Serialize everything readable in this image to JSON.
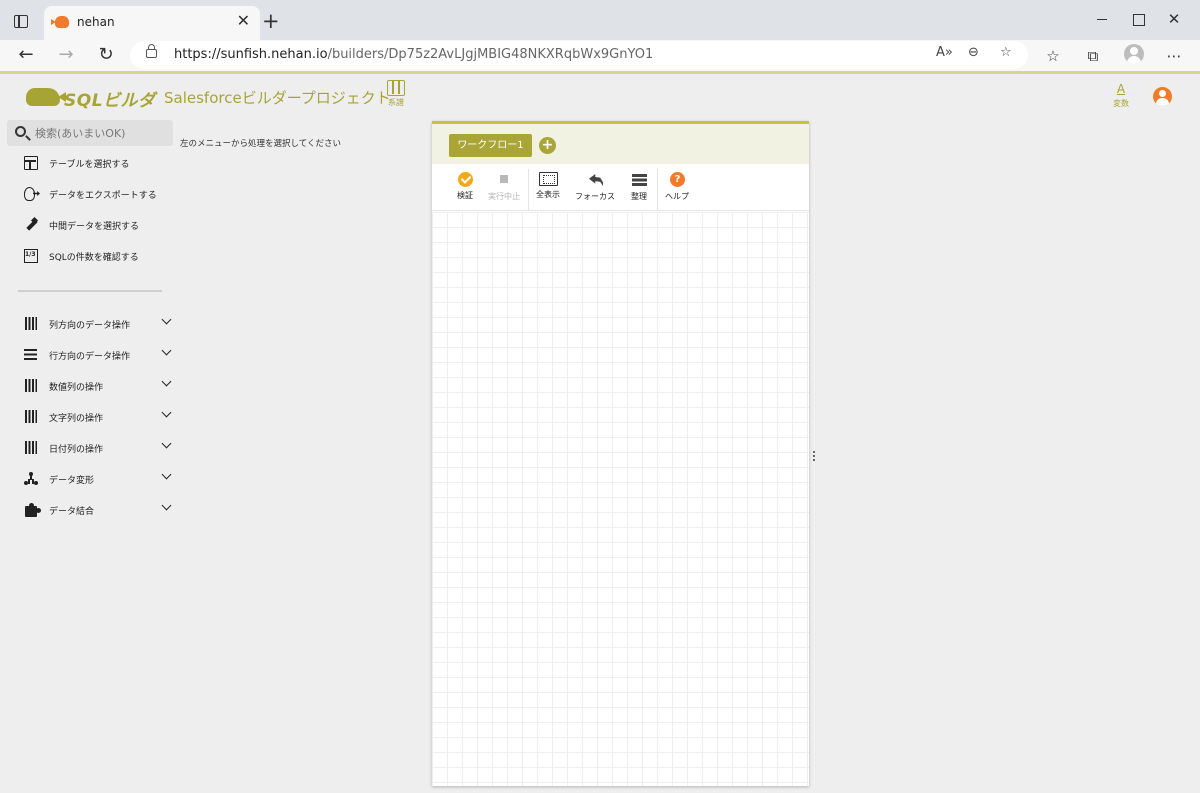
{
  "browser": {
    "tab_title": "nehan",
    "url_host": "https://sunfish.nehan.io",
    "url_path": "/builders/Dp75z2AvLJgjMBIG48NKXRqbWx9GnYO1"
  },
  "header": {
    "logo_text": "SQLビルダー",
    "project_title": "Salesforceビルダープロジェクト",
    "lineage_label": "系譜",
    "variables_icon": "A",
    "variables_label": "変数"
  },
  "sidebar": {
    "search_placeholder": "検索(あいまいOK)",
    "hint": "左のメニューから処理を選択してください",
    "top_items": [
      {
        "label": "テーブルを選択する",
        "icon": "table-icon"
      },
      {
        "label": "データをエクスポートする",
        "icon": "export-icon"
      },
      {
        "label": "中間データを選択する",
        "icon": "plug-icon"
      },
      {
        "label": "SQLの件数を確認する",
        "icon": "count-icon"
      }
    ],
    "categories": [
      {
        "label": "列方向のデータ操作",
        "icon": "columns-icon"
      },
      {
        "label": "行方向のデータ操作",
        "icon": "rows-icon"
      },
      {
        "label": "数値列の操作",
        "icon": "columns-icon"
      },
      {
        "label": "文字列の操作",
        "icon": "columns-icon"
      },
      {
        "label": "日付列の操作",
        "icon": "columns-icon"
      },
      {
        "label": "データ変形",
        "icon": "fork-icon"
      },
      {
        "label": "データ結合",
        "icon": "puzzle-icon"
      }
    ]
  },
  "workflow": {
    "tab_label": "ワークフロー1",
    "add_label": "+",
    "toolbar": [
      {
        "label": "検証",
        "icon": "check-circle-icon",
        "enabled": true
      },
      {
        "label": "実行中止",
        "icon": "stop-icon",
        "enabled": false
      },
      {
        "label": "全表示",
        "icon": "fit-screen-icon",
        "enabled": true
      },
      {
        "label": "フォーカス",
        "icon": "focus-arrow-icon",
        "enabled": true
      },
      {
        "label": "整理",
        "icon": "arrange-list-icon",
        "enabled": true
      },
      {
        "label": "ヘルプ",
        "icon": "help-icon",
        "enabled": true
      }
    ]
  },
  "colors": {
    "brand": "#a7a436",
    "accent_orange": "#f07b2a",
    "validate_yellow": "#f0a81d"
  }
}
